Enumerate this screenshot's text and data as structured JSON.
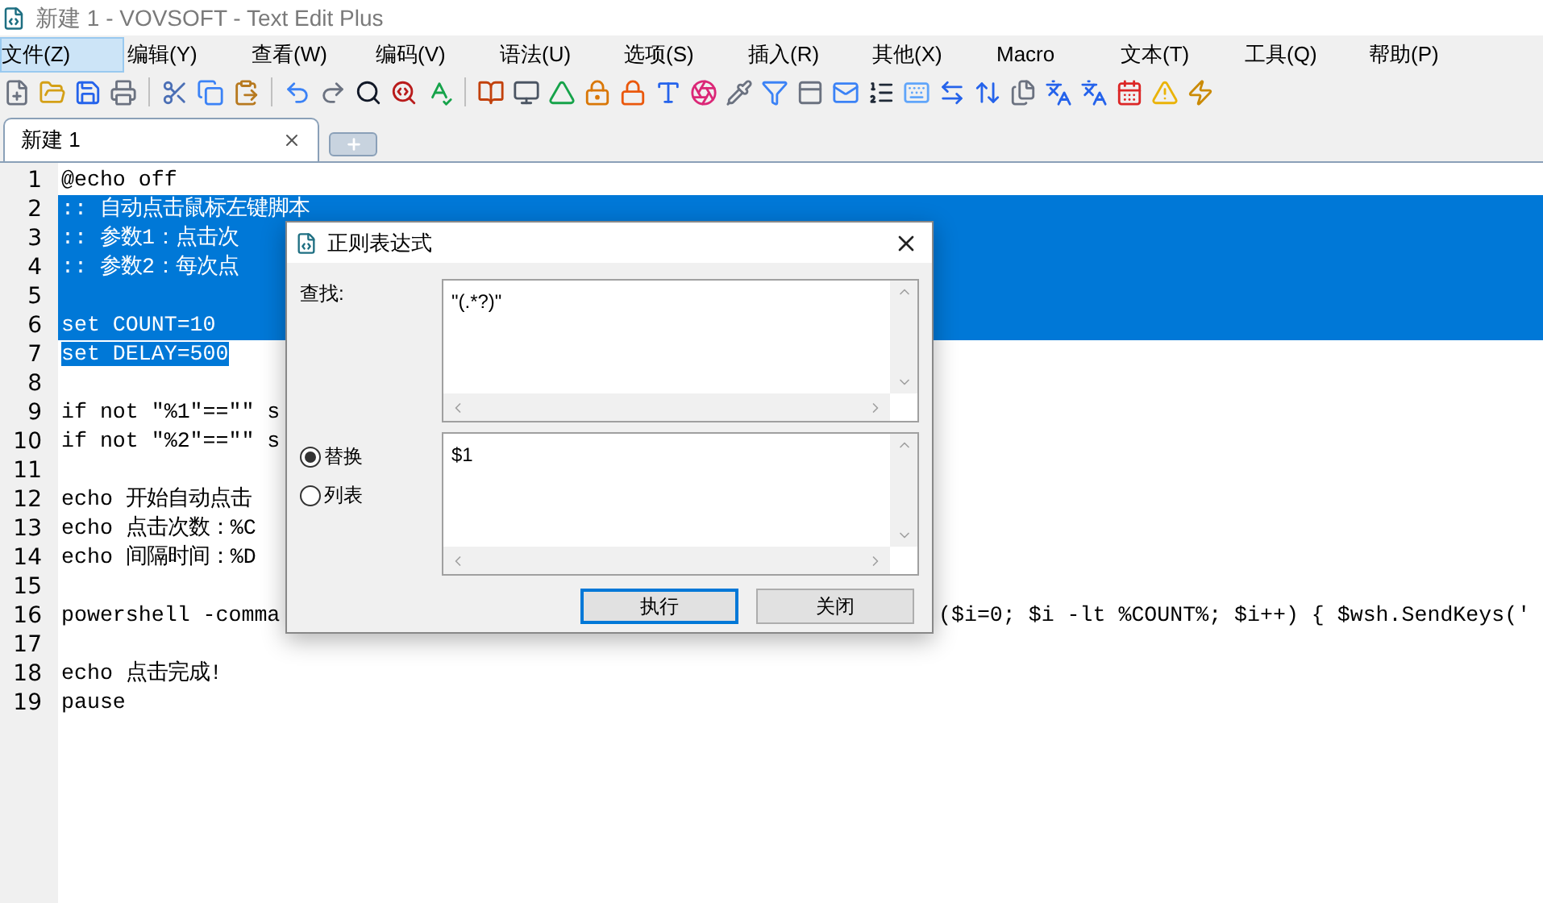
{
  "window": {
    "title": "新建 1 - VOVSOFT - Text Edit Plus"
  },
  "menu": [
    {
      "label": "文件(Z)",
      "selected": true
    },
    {
      "label": "编辑(Y)",
      "selected": false
    },
    {
      "label": "查看(W)",
      "selected": false
    },
    {
      "label": "编码(V)",
      "selected": false
    },
    {
      "label": "语法(U)",
      "selected": false
    },
    {
      "label": "选项(S)",
      "selected": false
    },
    {
      "label": "插入(R)",
      "selected": false
    },
    {
      "label": "其他(X)",
      "selected": false
    },
    {
      "label": "Macro",
      "selected": false
    },
    {
      "label": "文本(T)",
      "selected": false
    },
    {
      "label": "工具(Q)",
      "selected": false
    },
    {
      "label": "帮助(P)",
      "selected": false
    }
  ],
  "tabs": [
    {
      "label": "新建 1",
      "selected": true
    }
  ],
  "editor": {
    "lines": [
      {
        "number": "1",
        "text": "@echo off",
        "selected": false
      },
      {
        "number": "2",
        "text": ":: 自动点击鼠标左键脚本",
        "selected": true,
        "full_width": true
      },
      {
        "number": "3",
        "text": ":: 参数1：点击次",
        "selected": true,
        "full_width": true
      },
      {
        "number": "4",
        "text": ":: 参数2：每次点",
        "selected": true,
        "full_width": true
      },
      {
        "number": "5",
        "selected": true,
        "full_width": true
      },
      {
        "number": "6",
        "text": "set COUNT=10",
        "selected": true,
        "full_width": true
      },
      {
        "number": "7",
        "text": "set DELAY=500",
        "selected": true,
        "full_width": false
      },
      {
        "number": "8",
        "selected": false
      },
      {
        "number": "9",
        "text": "if not \"%1\"==\"\" s",
        "selected": false
      },
      {
        "number": "10",
        "text": "if not \"%2\"==\"\" s",
        "selected": false
      },
      {
        "number": "11",
        "selected": false
      },
      {
        "number": "12",
        "text": "echo 开始自动点击",
        "selected": false
      },
      {
        "number": "13",
        "text": "echo 点击次数：%C",
        "selected": false
      },
      {
        "number": "14",
        "text": "echo 间隔时间：%D",
        "selected": false
      },
      {
        "number": "15",
        "selected": false
      },
      {
        "number": "16",
        "text": "powershell -comma",
        "tail": "($i=0; $i -lt %COUNT%; $i++) { $wsh.SendKeys('",
        "selected": false
      },
      {
        "number": "17",
        "selected": false
      },
      {
        "number": "18",
        "text": "echo 点击完成!",
        "selected": false
      },
      {
        "number": "19",
        "text": "pause",
        "selected": false
      }
    ]
  },
  "dialog": {
    "title": "正则表达式",
    "find_label": "查找:",
    "find_value": "\"(.*?)\"",
    "modes": [
      {
        "label": "替换",
        "selected": true
      },
      {
        "label": "列表",
        "selected": false
      }
    ],
    "replace_value": "$1",
    "buttons": [
      {
        "label": "执行",
        "focused": true
      },
      {
        "label": "关闭",
        "focused": false
      }
    ]
  }
}
